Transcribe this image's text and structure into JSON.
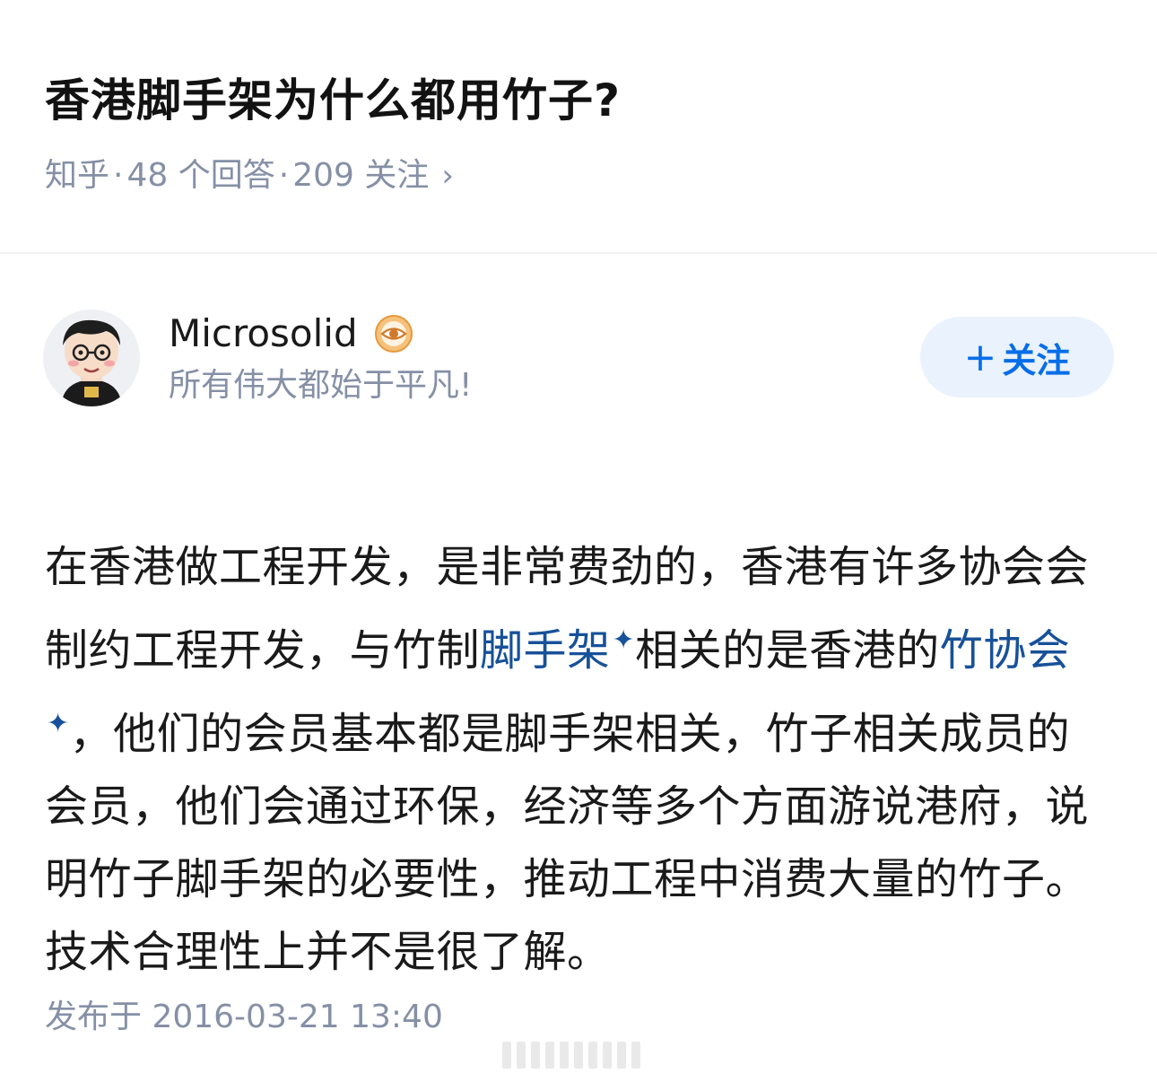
{
  "question": {
    "title": "香港脚手架为什么都用竹子?",
    "source": "知乎",
    "sep1": "·",
    "answers_count": "48 个回答",
    "sep2": "·",
    "followers_count": "209 关注",
    "chevron": "›"
  },
  "author": {
    "avatar_icon": "avatar-cartoon-man-icon",
    "name": "Microsolid",
    "badge_icon": "eye-badge-icon",
    "badge_color": "#f0a050",
    "bio": "所有伟大都始于平凡!"
  },
  "follow_button": {
    "plus": "+",
    "label": "关注",
    "bg": "#eaf2fd",
    "color": "#056de8"
  },
  "answer": {
    "seg1": "在香港做工程开发，是非常费劲的，香港有许多协会会制约工程开发，与竹制",
    "link1": "脚手架",
    "seg2": "相关的是香港的",
    "link2": "竹协会",
    "seg3": "，他们的会员基本都是脚手架相关，竹子相关成员的会员，他们会通过环保，经济等多个方面游说港府，说明竹子脚手架的必要性，推动工程中消费大量的竹子。技术合理性上并不是很了解。",
    "link_star": "✦",
    "link_color": "#175199"
  },
  "publish": {
    "label": "发布于 2016-03-21 13:40"
  }
}
